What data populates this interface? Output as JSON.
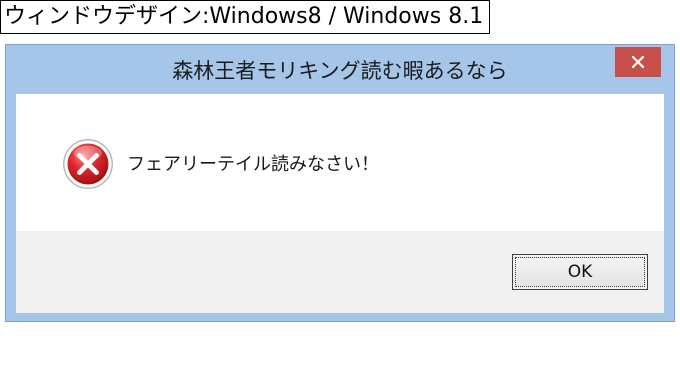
{
  "caption": "ウィンドウデザイン:Windows8 / Windows 8.1",
  "window": {
    "title": "森林王者モリキング読む暇あるなら",
    "close_label": "×",
    "message": "フェアリーテイル読みなさい！",
    "ok_label": "OK",
    "icon": "error-icon"
  },
  "colors": {
    "frame": "#a5c6e8",
    "close_button": "#c7504a",
    "content_bg": "#ffffff",
    "button_area_bg": "#f0f0f0",
    "error_red": "#d8232a"
  }
}
